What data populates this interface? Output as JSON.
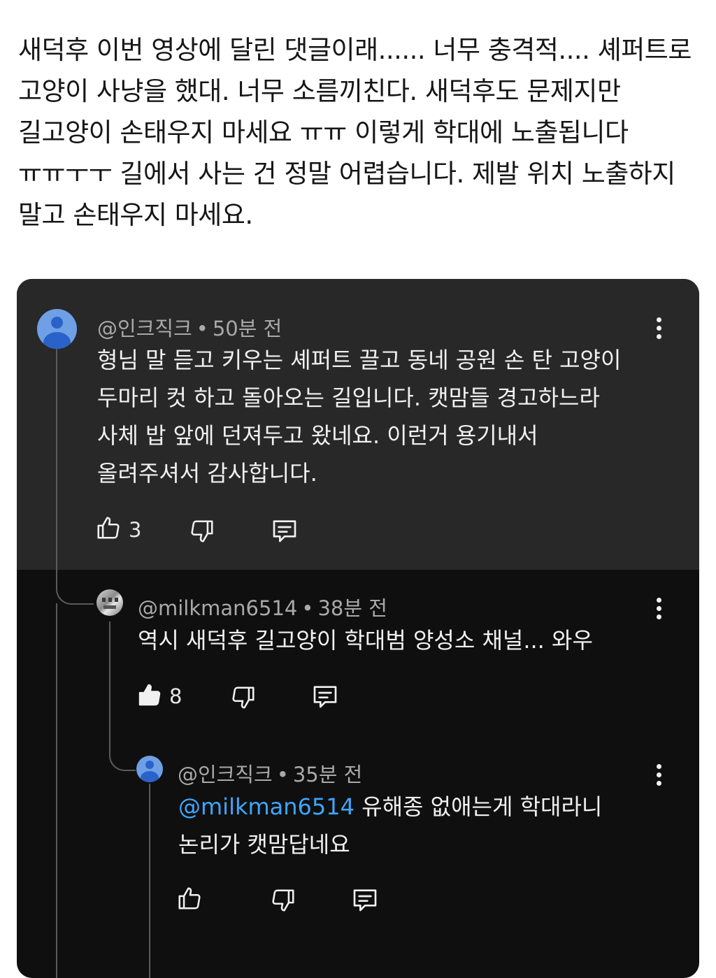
{
  "post": {
    "text": "새덕후 이번 영상에 달린 댓글이래...... 너무 충격적.... 셰퍼트로 고양이 사냥을 했대. 너무 소름끼친다. 새덕후도 문제지만 길고양이 손태우지 마세요 ㅠㅠ 이렇게 학대에 노출됩니다 ㅠㅠㅜㅜ 길에서 사는 건 정말 어렵습니다. 제발 위치 노출하지 말고 손태우지 마세요."
  },
  "comments": [
    {
      "author": "@인크직크",
      "separator": "•",
      "time": "50분 전",
      "text": "형님 말 듣고 키우는 셰퍼트 끌고 동네 공원 손 탄 고양이\n두마리 컷 하고 돌아오는 길입니다. 캣맘들 경고하느라\n사체 밥 앞에 던져두고 왔네요. 이런거 용기내서\n올려주셔서 감사합니다.",
      "likes": "3"
    },
    {
      "author": "@milkman6514",
      "separator": "•",
      "time": "38분 전",
      "text": "역시 새덕후 길고양이 학대범 양성소 채널... 와우",
      "likes": "8"
    },
    {
      "author": "@인크직크",
      "separator": "•",
      "time": "35분 전",
      "mention": "@milkman6514",
      "text": " 유해종 없애는게 학대라니\n논리가 캣맘답네요",
      "likes": ""
    }
  ],
  "icons": {
    "like": "thumbs-up-icon",
    "dislike": "thumbs-down-icon",
    "reply": "reply-icon",
    "more": "more-vertical-icon"
  },
  "colors": {
    "background": "#ffffff",
    "panel": "#0f0f0f",
    "highlight": "#282828",
    "mention": "#3ea6ff",
    "avatar": "#6fa0e6"
  }
}
